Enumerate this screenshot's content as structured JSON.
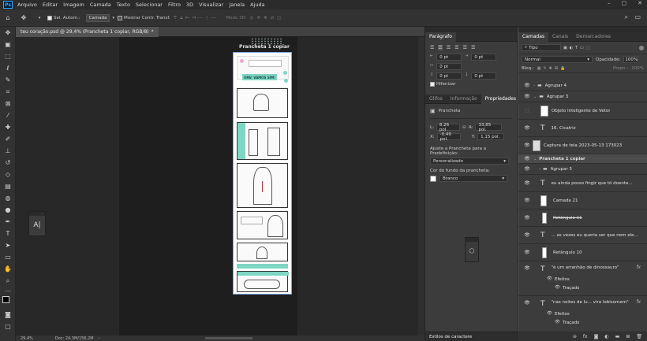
{
  "app": {
    "logo": "Ps",
    "menu": [
      "Arquivo",
      "Editar",
      "Imagem",
      "Camada",
      "Texto",
      "Selecionar",
      "Filtro",
      "3D",
      "Visualizar",
      "Janela",
      "Ajuda"
    ]
  },
  "options": {
    "auto_select_label": "Sel. Autom.:",
    "auto_select_value": "Camada",
    "show_transform_label": "Mostrar Contr. Transf.",
    "mode3d_label": "Modo 3D:"
  },
  "document": {
    "tab_title": "teu coração.psd @ 29,4% (Prancheta 1 copiar, RGB/8)",
    "tab_suffix": "*",
    "artboard_title": "Prancheta 1 copiar",
    "zoom": "29,4%",
    "doc_size": "Doc: 24,3M/156,2M"
  },
  "panel_paragraph": {
    "title": "Parágrafo",
    "indent_values": [
      "0 pt",
      "0 pt",
      "0 pt",
      "0 pt",
      "0 pt"
    ],
    "hyphenate_label": "Hifenizar"
  },
  "panel_props": {
    "tabs": [
      "Glifos",
      "Informação",
      "Propriedades"
    ],
    "active_tab": "Propriedades",
    "object": "Prancheta",
    "L_label": "L:",
    "L_value": "8,26 pol.",
    "A_label": "A:",
    "A_value": "33,85 pol.",
    "X_label": "X:",
    "X_value": "-0,49 pol.",
    "Y_label": "Y:",
    "Y_value": "1,15 pol.",
    "preset_label": "Ajuste a Prancheta para a Predefinição:",
    "preset_value": "Personalizado",
    "bg_label": "Cor do fundo da prancheta:",
    "bg_value": "Branco"
  },
  "char_styles": {
    "title": "Estilos de caractere"
  },
  "layers": {
    "tabs": [
      "Camadas",
      "Canais",
      "Demarcadores"
    ],
    "kind": "Tipo",
    "blend": "Normal",
    "opacity_label": "Opacidade:",
    "opacity": "100%",
    "lock_label": "Bloq.:",
    "fill_label": "Preen.:",
    "fill": "100%",
    "items": [
      {
        "name": "Agrupar 4",
        "kind": "group"
      },
      {
        "name": "Agrupar 3",
        "kind": "group-open"
      },
      {
        "name": "Objeto Inteligente de Vetor",
        "kind": "smart"
      },
      {
        "name": "16. Cicatriz",
        "kind": "text"
      },
      {
        "name": "Captura de tela 2023-05-13 173023",
        "kind": "image"
      },
      {
        "name": "Prancheta 1 copiar",
        "kind": "artboard"
      },
      {
        "name": "Agrupar 5",
        "kind": "group"
      },
      {
        "name": "eu ainda posso fingir que tô doente...",
        "kind": "text"
      },
      {
        "name": "Camada 21",
        "kind": "image"
      },
      {
        "name": "Retângulo 11",
        "kind": "shape"
      },
      {
        "name": "... as vezes eu queria ser que nem ele...",
        "kind": "text"
      },
      {
        "name": "Retângulo 10",
        "kind": "shape"
      },
      {
        "name": "\"é um arranhão de dinossauro\"",
        "kind": "text-fx"
      },
      {
        "name": "\"nas noites de lu... vira lobisomem\"",
        "kind": "text-fx"
      }
    ],
    "effects_label": "Efeitos",
    "stroke_label": "Traçado"
  },
  "comic": {
    "pill1": "OPA! VAMOS SIM!"
  },
  "float_tool": {
    "label": "A|"
  }
}
